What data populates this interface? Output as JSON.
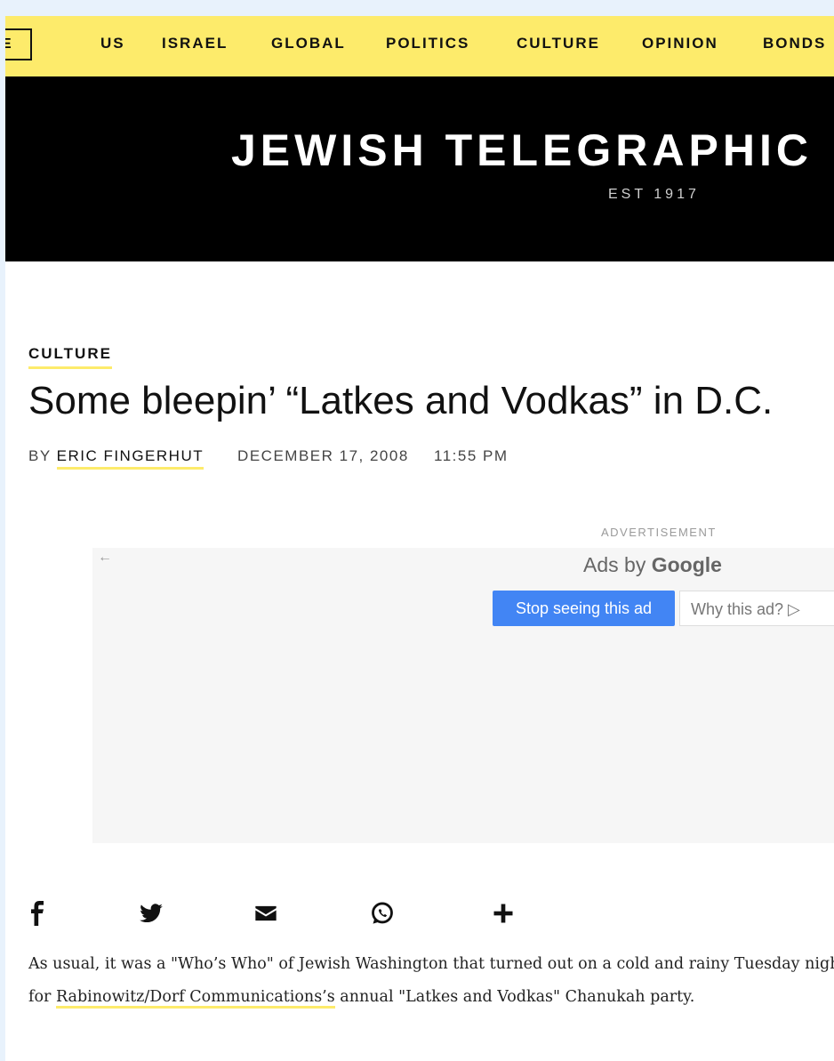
{
  "nav": {
    "edge_label": "E",
    "items": [
      "US",
      "ISRAEL",
      "GLOBAL",
      "POLITICS",
      "CULTURE",
      "OPINION",
      "BONDS"
    ]
  },
  "masthead": {
    "title": "JEWISH TELEGRAPHIC",
    "est": "EST 1917"
  },
  "article": {
    "section": "CULTURE",
    "headline": "Some bleepin’ “Latkes and Vodkas” in D.C.",
    "by": "BY",
    "author": "ERIC FINGERHUT",
    "date": "DECEMBER 17, 2008",
    "time": "11:55 PM",
    "body": {
      "p1_before": "As usual, it was a \"Who’s Who\" of Jewish Washington that turned out on a cold and rainy Tuesday night for ",
      "p1_link": "Rabinowitz/Dorf Communications’s",
      "p1_after": " annual \"Latkes and Vodkas\" Chanukah party."
    }
  },
  "ad": {
    "label": "ADVERTISEMENT",
    "back_arrow": "←",
    "ads_by": "Ads by",
    "google": "Google",
    "stop_label": "Stop seeing this ad",
    "why_label": "Why this ad? ▷"
  },
  "share": {
    "icons": [
      "facebook-icon",
      "twitter-icon",
      "email-icon",
      "whatsapp-icon",
      "plus-icon"
    ]
  },
  "colors": {
    "nav_bg": "#fdeb6b",
    "masthead_bg": "#000000",
    "accent_underline": "#fdeb6b",
    "ad_button": "#4285f4",
    "page_bg": "#e8f2fc"
  }
}
